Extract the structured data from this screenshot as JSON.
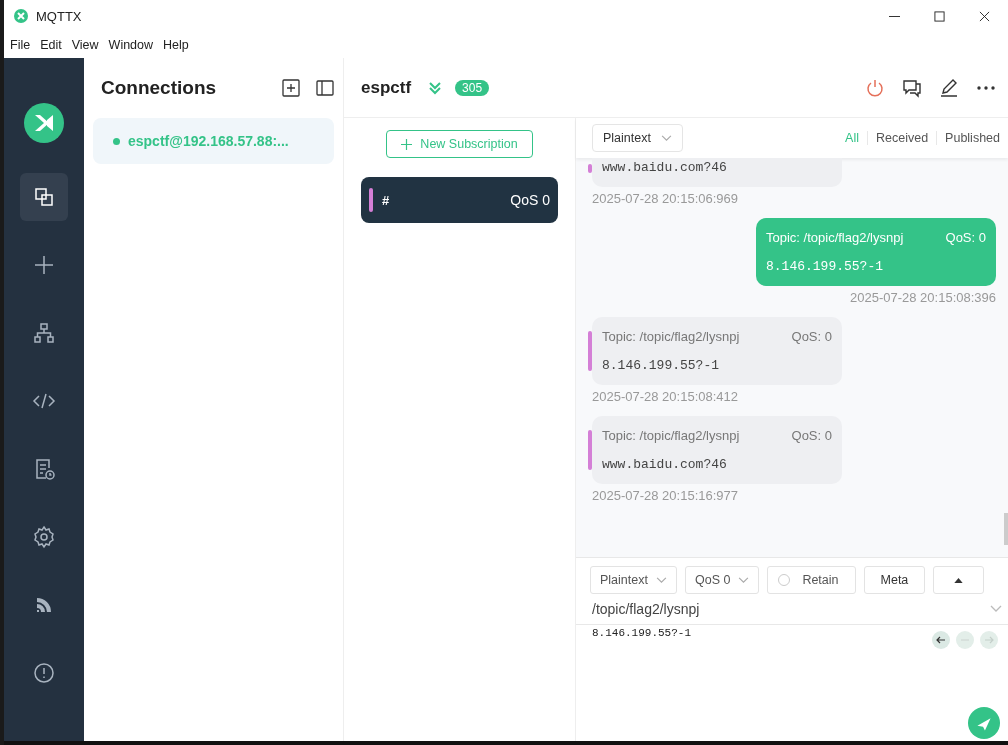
{
  "window": {
    "title": "MQTTX"
  },
  "menu": [
    "File",
    "Edit",
    "View",
    "Window",
    "Help"
  ],
  "sidebar": {
    "items": [
      {
        "kind": "connections",
        "selected": true
      },
      {
        "kind": "new",
        "selected": false
      },
      {
        "kind": "topology",
        "selected": false
      },
      {
        "kind": "script",
        "selected": false
      },
      {
        "kind": "log",
        "selected": false
      },
      {
        "kind": "settings",
        "selected": false
      },
      {
        "kind": "feed",
        "selected": false
      },
      {
        "kind": "about",
        "selected": false
      }
    ]
  },
  "connections": {
    "title": "Connections",
    "items": [
      {
        "name": "espctf@192.168.57.88:...",
        "selected": true,
        "color": "#34c388"
      }
    ]
  },
  "header": {
    "name": "espctf",
    "count": "305"
  },
  "subscriptions": {
    "button": "New Subscription",
    "items": [
      {
        "topic": "#",
        "qos": "QoS 0",
        "color": "#d47fd6",
        "selected": true
      }
    ]
  },
  "filter": {
    "format": "Plaintext",
    "tabs": [
      {
        "label": "All",
        "selected": true
      },
      {
        "label": "Received",
        "selected": false
      },
      {
        "label": "Published",
        "selected": false
      }
    ]
  },
  "messages": [
    {
      "kind": "received",
      "payload": "www.baidu.com?46",
      "time": "2025-07-28 20:15:06:969"
    },
    {
      "kind": "sent",
      "topic": "Topic: /topic/flag2/lysnpj",
      "qos": "QoS: 0",
      "payload": "8.146.199.55?-1",
      "time": "2025-07-28 20:15:08:396"
    },
    {
      "kind": "received",
      "topic": "Topic: /topic/flag2/lysnpj",
      "qos": "QoS: 0",
      "payload": "8.146.199.55?-1",
      "time": "2025-07-28 20:15:08:412"
    },
    {
      "kind": "received",
      "topic": "Topic: /topic/flag2/lysnpj",
      "qos": "QoS: 0",
      "payload": "www.baidu.com?46",
      "time": "2025-07-28 20:15:16:977"
    }
  ],
  "publish": {
    "format": "Plaintext",
    "qos": "QoS 0",
    "retain": {
      "label": "Retain",
      "checked": false
    },
    "meta": "Meta",
    "topic": "/topic/flag2/lysnpj",
    "payload": "8.146.199.55?-1"
  }
}
